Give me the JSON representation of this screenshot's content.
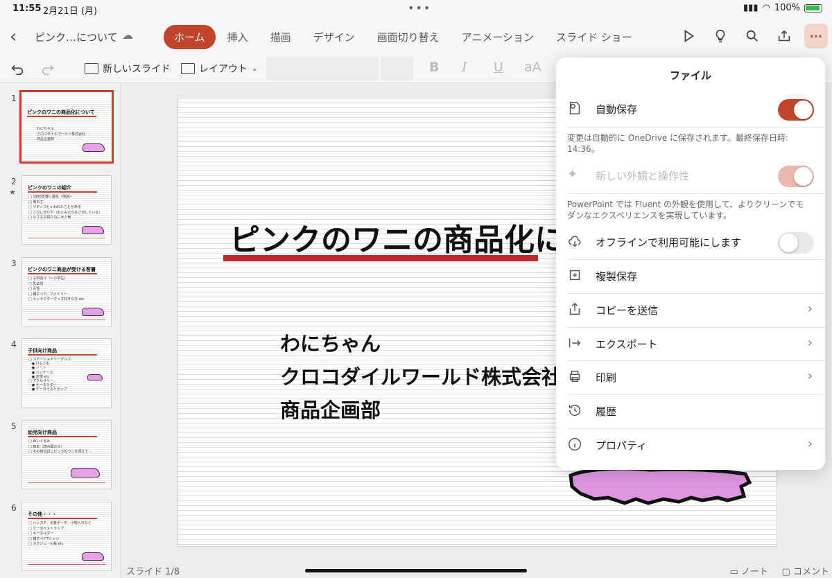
{
  "status": {
    "time": "11:55",
    "date": "2月21日 (月)",
    "battery": "100%"
  },
  "header": {
    "back_icon": "chevron-left-icon",
    "doc_title": "ピンク…について",
    "tabs": [
      "ホーム",
      "挿入",
      "描画",
      "デザイン",
      "画面切り替え",
      "アニメーション",
      "スライド ショー"
    ],
    "active_tab": "ホーム",
    "accent": "#c0452b"
  },
  "toolbar": {
    "new_slide": "新しいスライド",
    "layout": "レイアウト",
    "bold": "B",
    "italic": "I",
    "underline": "U",
    "font_size": "aA"
  },
  "thumbnails": [
    {
      "num": "1",
      "title": "ピンクのワニの商品化について",
      "lines": "わにちゃん\nクロコダイルワールド株式会社\n商品企画部"
    },
    {
      "num": "2",
      "title": "ピンクのワニの紹介",
      "lines": "□ 1995年春に誕生（他説）\n□ 男の子\n□ ツチノコといわれたことがある\n□ さびしがりや（おともだちをさがしている）\n□ 小さな子供たちに大人気"
    },
    {
      "num": "3",
      "title": "ピンクのワニ商品が受ける客層",
      "lines": "□ 子供向け（〜小学生）\n□ 乳幼児\n□ 女性\n□ 親子ペア、ファミリー\n□ キャラクターグッズ好きな方 etc"
    },
    {
      "num": "4",
      "title": "子供向け商品",
      "lines": "□ ステーショナリーグッズ\n   ● けしごむ\n   ● ノート\n   ● ペンケース\n   ● 定規 etc\n□ アクセサリー\n   ● キーホルダー\n   ● ケータイストラップ"
    },
    {
      "num": "5",
      "title": "幼児向け商品",
      "lines": "□ ぬいぐるみ\n□ 絵本（読み聞かせ）\n□ その他玩具にピンクのワニを添えて…"
    },
    {
      "num": "6",
      "title": "その他・・・",
      "lines": "□ ハンカチ、化粧ポーチ、小物入れなど\n□ ケータイストラップ\n□ キーホルダー\n□ 親子ペアTシャツ\n□ スケジュール帳 etc"
    }
  ],
  "slide": {
    "title": "ピンクのワニの商品化について",
    "subtitle_lines": [
      "わにちゃん",
      "クロコダイルワールド株式会社",
      "商品企画部"
    ]
  },
  "footer": {
    "slide_count": "スライド 1/8",
    "notes": "ノート",
    "comments": "コメント"
  },
  "file_menu": {
    "title": "ファイル",
    "autosave": {
      "label": "自動保存",
      "on": true
    },
    "autosave_desc": "変更は自動的に OneDrive に保存されます。最終保存日時: 14:36。",
    "new_look": {
      "label": "新しい外観と操作性",
      "on": true
    },
    "new_look_desc": "PowerPoint では Fluent の外観を使用して、よりクリーンでモダンなエクスペリエンスを実現しています。",
    "offline": {
      "label": "オフラインで利用可能にします",
      "on": false
    },
    "duplicate": "複製保存",
    "send_copy": "コピーを送信",
    "export": "エクスポート",
    "print": "印刷",
    "history": "履歴",
    "properties": "プロパティ"
  }
}
